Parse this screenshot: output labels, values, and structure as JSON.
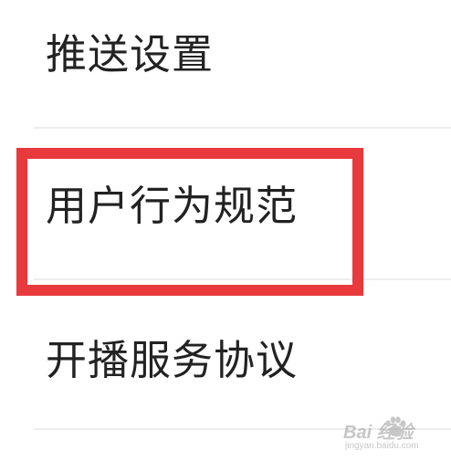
{
  "settings": {
    "items": [
      {
        "label": "推送设置"
      },
      {
        "label": "用户行为规范"
      },
      {
        "label": "开播服务协议"
      }
    ]
  },
  "annotation": {
    "highlight_color": "#e8393c",
    "highlighted_item": "用户行为规范"
  },
  "watermark": {
    "logo_text": "Bai 经验",
    "url": "jingyan.baidu.com"
  }
}
